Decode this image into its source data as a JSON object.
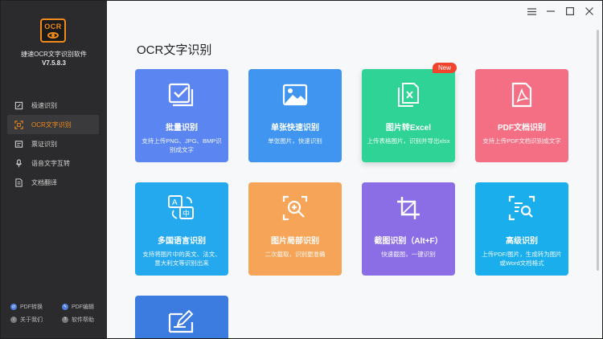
{
  "app": {
    "logo_text": "OCR",
    "name": "捷速OCR文字识别软件",
    "version": "V7.5.8.3"
  },
  "sidebar": {
    "items": [
      {
        "label": "极速识别",
        "icon": "bolt-icon",
        "active": false
      },
      {
        "label": "OCR文字识别",
        "icon": "scan-frame-icon",
        "active": true
      },
      {
        "label": "票证识别",
        "icon": "ticket-icon",
        "active": false
      },
      {
        "label": "语音文字互转",
        "icon": "microphone-icon",
        "active": false
      },
      {
        "label": "文档翻译",
        "icon": "translate-doc-icon",
        "active": false
      }
    ],
    "footer": [
      {
        "label": "PDF转换",
        "icon": "pdf-convert-icon"
      },
      {
        "label": "PDF编辑",
        "icon": "pdf-edit-icon"
      },
      {
        "label": "关于我们",
        "icon": "info-icon"
      },
      {
        "label": "软件帮助",
        "icon": "help-icon"
      }
    ]
  },
  "window": {
    "controls": [
      "menu",
      "minimize",
      "maximize",
      "close"
    ]
  },
  "main": {
    "title": "OCR文字识别",
    "cards": [
      {
        "title": "批量识别",
        "desc": "支持上传PNG、JPG、BMP识别成文字",
        "color": "#5b86f2",
        "icon": "batch-check-icon"
      },
      {
        "title": "单张快速识别",
        "desc": "单张图片，快速识别",
        "color": "#3f95ef",
        "icon": "image-icon"
      },
      {
        "title": "图片转Excel",
        "desc": "上传表格图片，识别并导出xlsx",
        "color": "#2fd396",
        "icon": "excel-icon",
        "badge": "New"
      },
      {
        "title": "PDF文档识别",
        "desc": "支持上传PDF文档识别成文字",
        "color": "#f46f83",
        "icon": "pdf-icon"
      },
      {
        "title": "多国语言识别",
        "desc": "支持将图片中的英文、法文、意大利文等识别出来",
        "color": "#25a9ee",
        "icon": "language-icon"
      },
      {
        "title": "图片局部识别",
        "desc": "二次截取，识别更准确",
        "color": "#f6a457",
        "icon": "zoom-frame-icon"
      },
      {
        "title": "截图识别（Alt+F）",
        "desc": "快速截图，一键识别",
        "color": "#8b6ee6",
        "icon": "crop-icon"
      },
      {
        "title": "高级识别",
        "desc": "上传PDF/图片，生成转为图片或Word文档格式",
        "color": "#1aaeed",
        "icon": "advanced-search-icon"
      },
      {
        "title": "",
        "desc": "",
        "color": "#3c7be0",
        "icon": "edit-doc-icon"
      }
    ]
  }
}
